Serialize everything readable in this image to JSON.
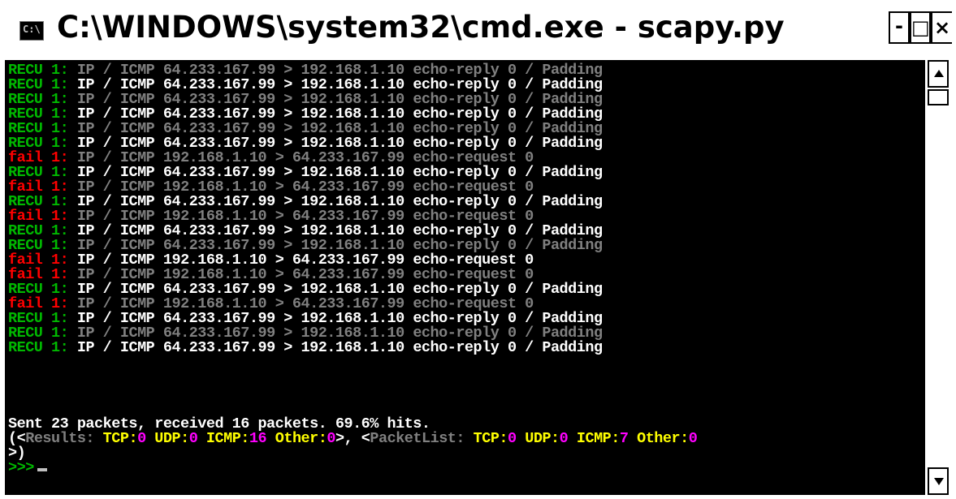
{
  "window": {
    "title": "C:\\WINDOWS\\system32\\cmd.exe - scapy.py",
    "icon": "cmd-console-icon",
    "icon_text": "C:\\"
  },
  "controls": {
    "minimize": "-",
    "maximize": "□",
    "close": "×"
  },
  "colors": {
    "recv": "#00b800",
    "fail": "#ff0000",
    "bright": "#ffffff",
    "dim": "#808080",
    "yellow": "#ffff00",
    "magenta": "#ff00ff"
  },
  "packets": [
    {
      "status": "RECU",
      "count": "1:",
      "text": " IP / ICMP 64.233.167.99 > 192.168.1.10 echo-reply 0 / Padding",
      "bright": false
    },
    {
      "status": "RECU",
      "count": "1:",
      "text": " IP / ICMP 64.233.167.99 > 192.168.1.10 echo-reply 0 / Padding",
      "bright": true
    },
    {
      "status": "RECU",
      "count": "1:",
      "text": " IP / ICMP 64.233.167.99 > 192.168.1.10 echo-reply 0 / Padding",
      "bright": false
    },
    {
      "status": "RECU",
      "count": "1:",
      "text": " IP / ICMP 64.233.167.99 > 192.168.1.10 echo-reply 0 / Padding",
      "bright": true
    },
    {
      "status": "RECU",
      "count": "1:",
      "text": " IP / ICMP 64.233.167.99 > 192.168.1.10 echo-reply 0 / Padding",
      "bright": false
    },
    {
      "status": "RECU",
      "count": "1:",
      "text": " IP / ICMP 64.233.167.99 > 192.168.1.10 echo-reply 0 / Padding",
      "bright": true
    },
    {
      "status": "fail",
      "count": "1:",
      "text": " IP / ICMP 192.168.1.10 > 64.233.167.99 echo-request 0",
      "bright": false
    },
    {
      "status": "RECU",
      "count": "1:",
      "text": " IP / ICMP 64.233.167.99 > 192.168.1.10 echo-reply 0 / Padding",
      "bright": true
    },
    {
      "status": "fail",
      "count": "1:",
      "text": " IP / ICMP 192.168.1.10 > 64.233.167.99 echo-request 0",
      "bright": false
    },
    {
      "status": "RECU",
      "count": "1:",
      "text": " IP / ICMP 64.233.167.99 > 192.168.1.10 echo-reply 0 / Padding",
      "bright": true
    },
    {
      "status": "fail",
      "count": "1:",
      "text": " IP / ICMP 192.168.1.10 > 64.233.167.99 echo-request 0",
      "bright": false
    },
    {
      "status": "RECU",
      "count": "1:",
      "text": " IP / ICMP 64.233.167.99 > 192.168.1.10 echo-reply 0 / Padding",
      "bright": true
    },
    {
      "status": "RECU",
      "count": "1:",
      "text": " IP / ICMP 64.233.167.99 > 192.168.1.10 echo-reply 0 / Padding",
      "bright": false
    },
    {
      "status": "fail",
      "count": "1:",
      "text": " IP / ICMP 192.168.1.10 > 64.233.167.99 echo-request 0",
      "bright": true
    },
    {
      "status": "fail",
      "count": "1:",
      "text": " IP / ICMP 192.168.1.10 > 64.233.167.99 echo-request 0",
      "bright": false
    },
    {
      "status": "RECU",
      "count": "1:",
      "text": " IP / ICMP 64.233.167.99 > 192.168.1.10 echo-reply 0 / Padding",
      "bright": true
    },
    {
      "status": "fail",
      "count": "1:",
      "text": " IP / ICMP 192.168.1.10 > 64.233.167.99 echo-request 0",
      "bright": false
    },
    {
      "status": "RECU",
      "count": "1:",
      "text": " IP / ICMP 64.233.167.99 > 192.168.1.10 echo-reply 0 / Padding",
      "bright": true
    },
    {
      "status": "RECU",
      "count": "1:",
      "text": " IP / ICMP 64.233.167.99 > 192.168.1.10 echo-reply 0 / Padding",
      "bright": false
    },
    {
      "status": "RECU",
      "count": "1:",
      "text": " IP / ICMP 64.233.167.99 > 192.168.1.10 echo-reply 0 / Padding",
      "bright": true
    }
  ],
  "summary": {
    "sent_line": "Sent 23 packets, received 16 packets. 69.6% hits.",
    "results": {
      "open": "(<",
      "results_label": "Results:",
      "tcp_label": " TCP:",
      "tcp_value": "0",
      "udp_label": " UDP:",
      "udp_value": "0",
      "icmp_label": " ICMP:",
      "icmp_value": "16",
      "other_label": " Other:",
      "other_value": "0",
      "sep": ">, <",
      "packetlist_label": "PacketList:",
      "pl_tcp_label": " TCP:",
      "pl_tcp_value": "0",
      "pl_udp_label": " UDP:",
      "pl_udp_value": "0",
      "pl_icmp_label": " ICMP:",
      "pl_icmp_value": "7",
      "pl_other_label": " Other:",
      "pl_other_value": "0"
    },
    "close_line": ">)",
    "prompt": ">>>"
  },
  "scrollbar": {
    "up_icon": "scroll-up-arrow-icon",
    "down_icon": "scroll-down-arrow-icon"
  }
}
